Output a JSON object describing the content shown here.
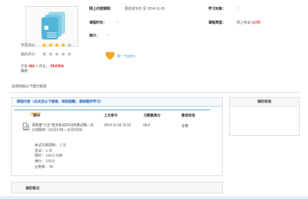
{
  "cover": {
    "icon": "document-stack-icon"
  },
  "ratings": {
    "student_label": "学员评分：",
    "student_stars": 4,
    "my_label": "我的评分：",
    "my_stars": 0
  },
  "stats": {
    "prefix": "已有",
    "count": "410",
    "middle": "人评论，",
    "percent": "78.676%",
    "suffix": "推荐"
  },
  "like": {
    "icon": "heart-icon",
    "label": "赞一下(687)"
  },
  "info": {
    "time_label": "网上内容期限：",
    "time_value": "报名成功日 至 2014-11-26",
    "target_label": "学习对象：",
    "target_value": "--",
    "duration_label": "课程时长：",
    "duration_value": "--",
    "type_label": "课程类型：",
    "type_value": "网上考试",
    "type_required": "(必修)",
    "intro_label": "简介：",
    "intro_value": "--"
  },
  "intro_text": "此培训由以下部分组成",
  "course_panel": {
    "title": "课程内容（点点击以下链接，特别提醒，请按顺序学习）",
    "headers": [
      "模块",
      "上次参与",
      "习题最高分",
      "最佳状态"
    ],
    "row": {
      "icon": "document-icon",
      "title": "调查者“六五”普法考试2014年度试卷—长沙浏阳市（11月17日—11月22日）",
      "last": "2014-11-18 12:15",
      "score": "69.0",
      "status": "合格"
    },
    "details": [
      "考试次数限制：  2 次",
      "尝试：  1 次",
      "限时：  100.0 分钟",
      "满分：  100.0",
      "合格率：  60"
    ]
  },
  "side": {
    "title": "我的状态",
    "status": "通过中"
  },
  "notes": {
    "title": "我的笔记"
  },
  "colors": {
    "accent": "#2a6ab7",
    "heart": "#f5a623",
    "star": "#f0b400",
    "required": "#cc0000"
  }
}
